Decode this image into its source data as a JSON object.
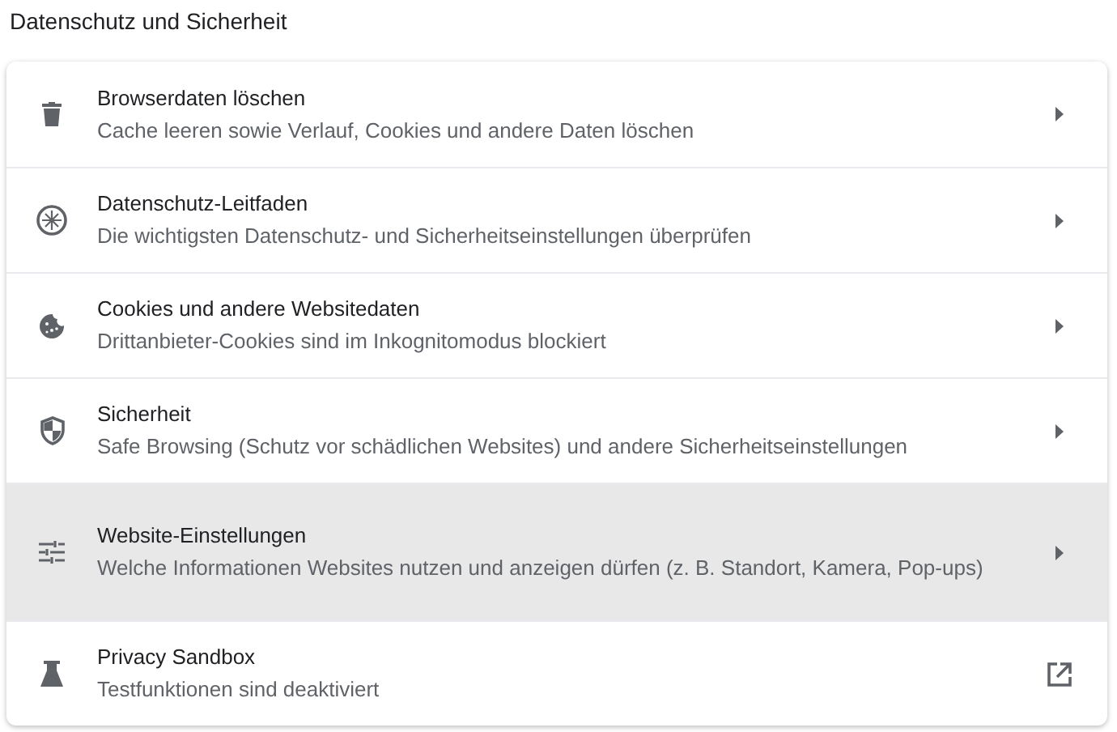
{
  "heading": "Datenschutz und Sicherheit",
  "items": [
    {
      "title": "Browserdaten löschen",
      "subtitle": "Cache leeren sowie Verlauf, Cookies und andere Daten löschen",
      "kind": "submenu",
      "highlighted": false
    },
    {
      "title": "Datenschutz-Leitfaden",
      "subtitle": "Die wichtigsten Datenschutz- und Sicherheitseinstellungen überprüfen",
      "kind": "submenu",
      "highlighted": false
    },
    {
      "title": "Cookies und andere Websitedaten",
      "subtitle": "Drittanbieter-Cookies sind im Inkognitomodus blockiert",
      "kind": "submenu",
      "highlighted": false
    },
    {
      "title": "Sicherheit",
      "subtitle": "Safe Browsing (Schutz vor schädlichen Websites) und andere Sicherheitseinstellungen",
      "kind": "submenu",
      "highlighted": false
    },
    {
      "title": "Website-Einstellungen",
      "subtitle": "Welche Informationen Websites nutzen und anzeigen dürfen (z. B. Standort, Kamera, Pop-ups)",
      "kind": "submenu",
      "highlighted": true
    },
    {
      "title": "Privacy Sandbox",
      "subtitle": "Testfunktionen sind deaktiviert",
      "kind": "external",
      "highlighted": false
    }
  ]
}
